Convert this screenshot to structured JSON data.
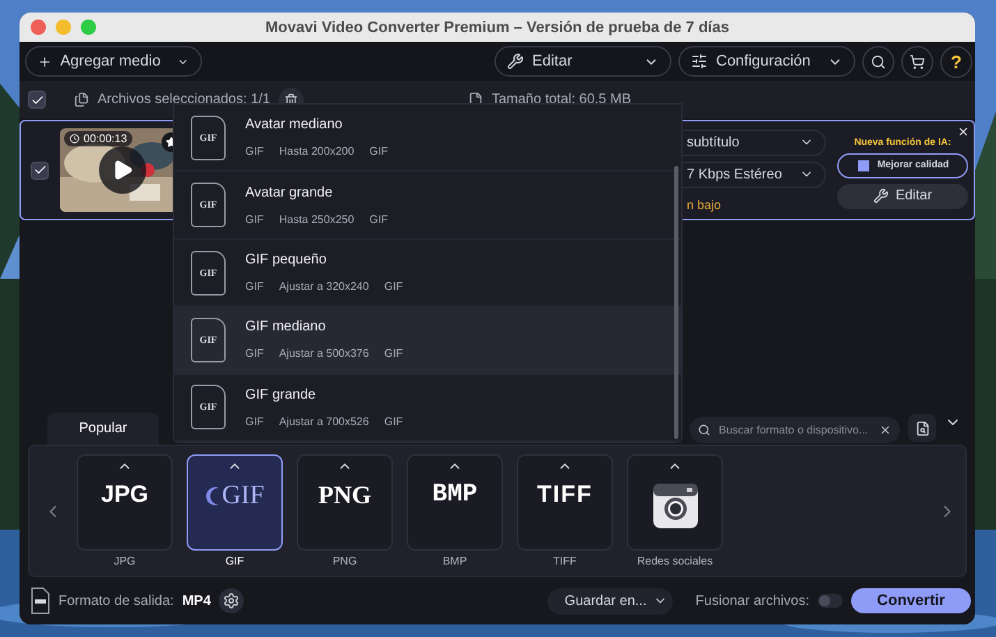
{
  "window": {
    "title": "Movavi Video Converter Premium – Versión de prueba de 7 días"
  },
  "toolbar": {
    "add_media": "Agregar medio",
    "edit": "Editar",
    "settings": "Configuración",
    "help": "?"
  },
  "file_bar": {
    "all_checked": true,
    "selected": "Archivos seleccionados: 1/1",
    "total_size": "Tamaño total: 60.5 MB"
  },
  "file": {
    "checked": true,
    "duration": "00:00:13",
    "subtitle": "subtítulo",
    "audio": "7 Kbps Estéreo",
    "quality_note": "n bajo",
    "ai_label": "Nueva función de IA:",
    "enhance_button": "Mejorar calidad",
    "edit_button": "Editar"
  },
  "preset_menu": {
    "items": [
      {
        "name": "Avatar mediano",
        "badge": "GIF",
        "specs": [
          "GIF",
          "Hasta 200x200",
          "GIF"
        ],
        "selected": false
      },
      {
        "name": "Avatar grande",
        "badge": "GIF",
        "specs": [
          "GIF",
          "Hasta 250x250",
          "GIF"
        ],
        "selected": false
      },
      {
        "name": "GIF pequeño",
        "badge": "GIF",
        "specs": [
          "GIF",
          "Ajustar a 320x240",
          "GIF"
        ],
        "selected": false
      },
      {
        "name": "GIF mediano",
        "badge": "GIF",
        "specs": [
          "GIF",
          "Ajustar a 500x376",
          "GIF"
        ],
        "selected": true
      },
      {
        "name": "GIF grande",
        "badge": "GIF",
        "specs": [
          "GIF",
          "Ajustar a 700x526",
          "GIF"
        ],
        "selected": false
      }
    ]
  },
  "tabs": [
    {
      "label": "Popular",
      "selected": true
    }
  ],
  "format_search": {
    "placeholder": "Buscar formato o dispositivo..."
  },
  "formats": [
    {
      "kind": "jpg",
      "logo": "JPG",
      "label": "JPG",
      "selected": false
    },
    {
      "kind": "gif",
      "logo": "GIF",
      "label": "GIF",
      "selected": true
    },
    {
      "kind": "png",
      "logo": "PNG",
      "label": "PNG",
      "selected": false
    },
    {
      "kind": "bmp",
      "logo": "BMP",
      "label": "BMP",
      "selected": false
    },
    {
      "kind": "tiff",
      "logo": "TIFF",
      "label": "TIFF",
      "selected": false
    },
    {
      "kind": "camera",
      "label": "Redes sociales",
      "selected": false
    }
  ],
  "output": {
    "label": "Formato de salida:",
    "value": "MP4"
  },
  "save_button": "Guardar en...",
  "merge": {
    "label": "Fusionar archivos:",
    "on": false
  },
  "convert_button": "Convertir"
}
